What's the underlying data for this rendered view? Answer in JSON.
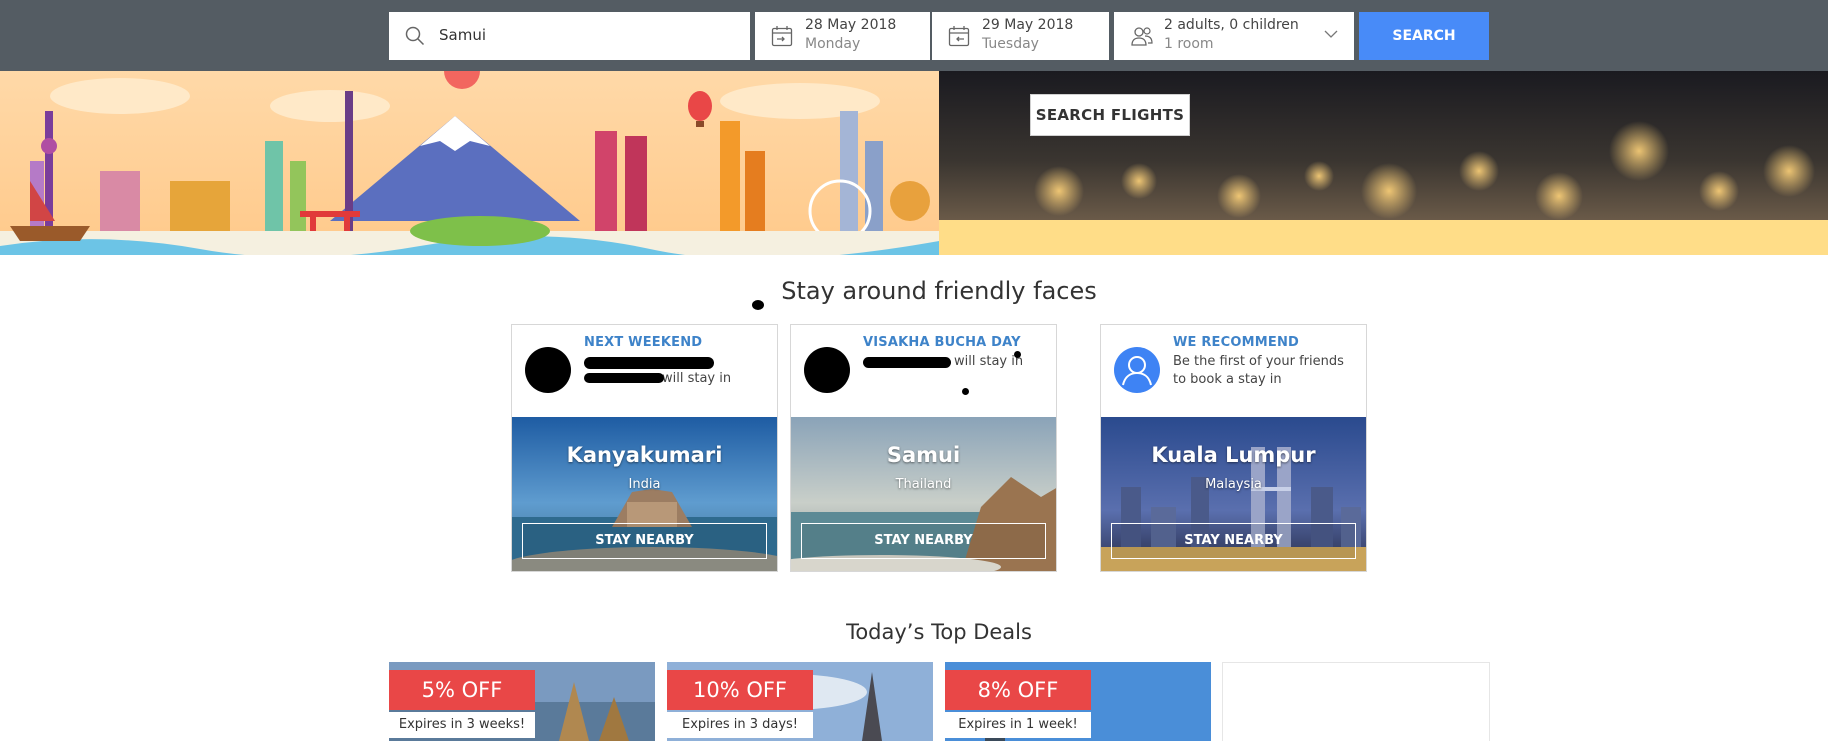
{
  "search": {
    "destination": "Samui",
    "checkin_date": "28 May 2018",
    "checkin_day": "Monday",
    "checkout_date": "29 May 2018",
    "checkout_day": "Tuesday",
    "occupancy": "2 adults, 0 children",
    "rooms": "1 room",
    "button": "SEARCH"
  },
  "hero": {
    "search_flights": "SEARCH FLIGHTS"
  },
  "friends": {
    "title": "Stay around friendly faces",
    "cards": [
      {
        "tag": "NEXT WEEKEND",
        "message": "will stay in",
        "city": "Kanyakumari",
        "country": "India",
        "button": "STAY NEARBY"
      },
      {
        "tag": "VISAKHA BUCHA DAY",
        "message": "will stay in",
        "city": "Samui",
        "country": "Thailand",
        "button": "STAY NEARBY"
      },
      {
        "tag": "WE RECOMMEND",
        "message": "Be the first of your friends to book a stay in",
        "city": "Kuala Lumpur",
        "country": "Malaysia",
        "button": "STAY NEARBY"
      }
    ]
  },
  "deals": {
    "title": "Today’s Top Deals",
    "items": [
      {
        "discount": "5% OFF",
        "expires": "Expires in 3 weeks!"
      },
      {
        "discount": "10% OFF",
        "expires": "Expires in 3 days!"
      },
      {
        "discount": "8% OFF",
        "expires": "Expires in 1 week!"
      }
    ]
  },
  "colors": {
    "topbar": "#545c63",
    "search_button": "#488bf8",
    "tag": "#3e83c9",
    "deal_badge": "#e94747"
  },
  "icons": [
    "search-icon",
    "calendar-checkin-icon",
    "calendar-checkout-icon",
    "guests-icon",
    "chevron-down-icon",
    "user-icon"
  ]
}
